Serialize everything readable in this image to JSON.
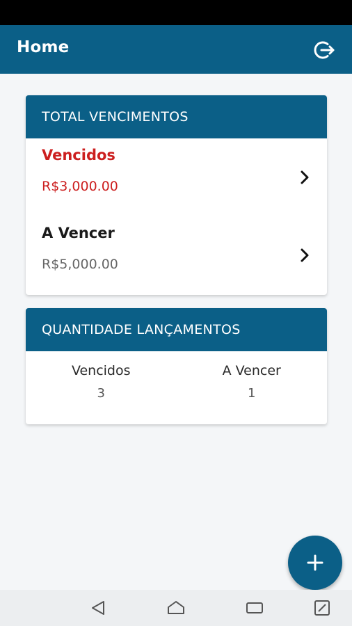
{
  "app_bar": {
    "title": "Home",
    "logout_icon": "logout-icon"
  },
  "total_due": {
    "header": "TOTAL VENCIMENTOS",
    "overdue": {
      "label": "Vencidos",
      "amount": "R$3,000.00",
      "color": "#cc1f1f"
    },
    "upcoming": {
      "label": "A Vencer",
      "amount": "R$5,000.00"
    }
  },
  "entry_count": {
    "header": "QUANTIDADE LANÇAMENTOS",
    "columns": [
      {
        "label": "Vencidos",
        "value": "3"
      },
      {
        "label": "A Vencer",
        "value": "1"
      }
    ]
  },
  "fab": {
    "icon": "plus-icon"
  },
  "colors": {
    "primary": "#0b5f87",
    "danger": "#cc1f1f",
    "background": "#f4f6f8"
  },
  "nav": [
    "back-icon",
    "home-icon",
    "recents-icon",
    "expand-icon"
  ]
}
